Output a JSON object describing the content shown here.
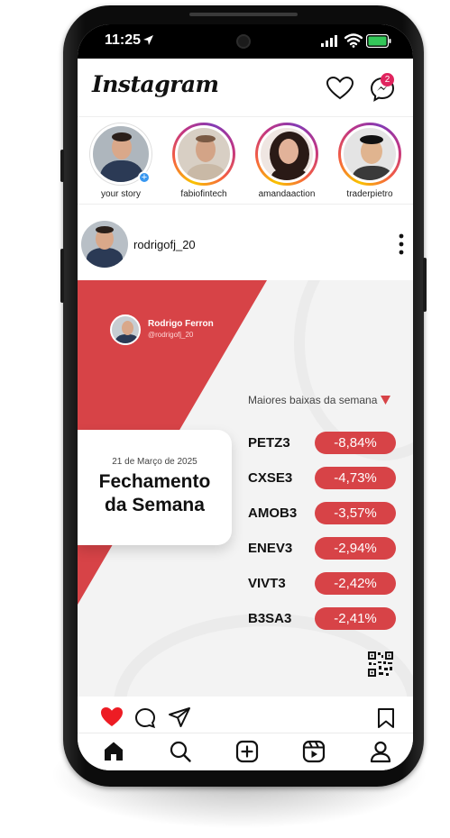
{
  "status_bar": {
    "time": "11:25"
  },
  "header": {
    "logo_text": "Instagram",
    "messages_badge": "2"
  },
  "stories": [
    {
      "username": "your story",
      "own": true
    },
    {
      "username": "fabiofintech",
      "own": false
    },
    {
      "username": "amandaaction",
      "own": false
    },
    {
      "username": "traderpietro",
      "own": false
    }
  ],
  "post": {
    "username": "rodrigofj_20",
    "author_name": "Rodrigo Ferron",
    "author_handle": "@rodrigofj_20",
    "card_date": "21 de Março de 2025",
    "card_title_line1": "Fechamento",
    "card_title_line2": "da Semana",
    "drops_title": "Maiores baixas da semana",
    "stocks": [
      {
        "ticker": "PETZ3",
        "change": "-8,84%"
      },
      {
        "ticker": "CXSE3",
        "change": "-4,73%"
      },
      {
        "ticker": "AMOB3",
        "change": "-3,57%"
      },
      {
        "ticker": "ENEV3",
        "change": "-2,94%"
      },
      {
        "ticker": "VIVT3",
        "change": "-2,42%"
      },
      {
        "ticker": "B3SA3",
        "change": "-2,41%"
      }
    ]
  },
  "colors": {
    "accent_red": "#d74347",
    "like_red": "#ed1c24",
    "story_badge_blue": "#3897f0",
    "battery_green": "#34c759"
  },
  "icons": [
    "location-arrow-icon",
    "signal-icon",
    "wifi-icon",
    "battery-icon",
    "heart-icon",
    "messenger-icon",
    "more-vertical-icon",
    "down-triangle-icon",
    "qr-code-icon",
    "like-filled-icon",
    "comment-icon",
    "share-icon",
    "bookmark-icon",
    "home-icon",
    "search-icon",
    "create-icon",
    "reels-icon",
    "profile-icon"
  ]
}
